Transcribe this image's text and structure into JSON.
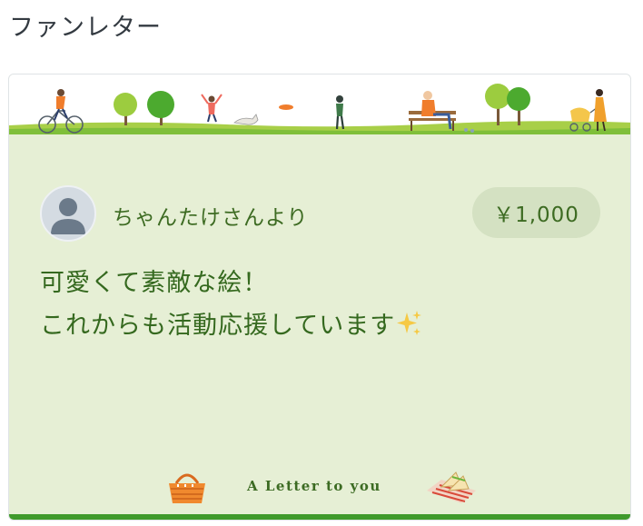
{
  "page": {
    "section_title": "ファンレター"
  },
  "letter": {
    "sender": "ちゃんたけさんより",
    "amount": "￥1,000",
    "message_lines": [
      "可愛くて素敵な絵！",
      "これからも活動応援しています"
    ],
    "footer_text": "A Letter to you"
  },
  "colors": {
    "card_background": "#e6efd5",
    "text_green": "#35691f",
    "badge_background": "#d4e1c2",
    "bottom_bar": "#3f9a2b"
  },
  "icons": {
    "sparkle": "sparkles-icon",
    "basket": "picnic-basket-icon",
    "sandwich": "sandwich-icon",
    "avatar": "default-user-avatar-icon"
  }
}
